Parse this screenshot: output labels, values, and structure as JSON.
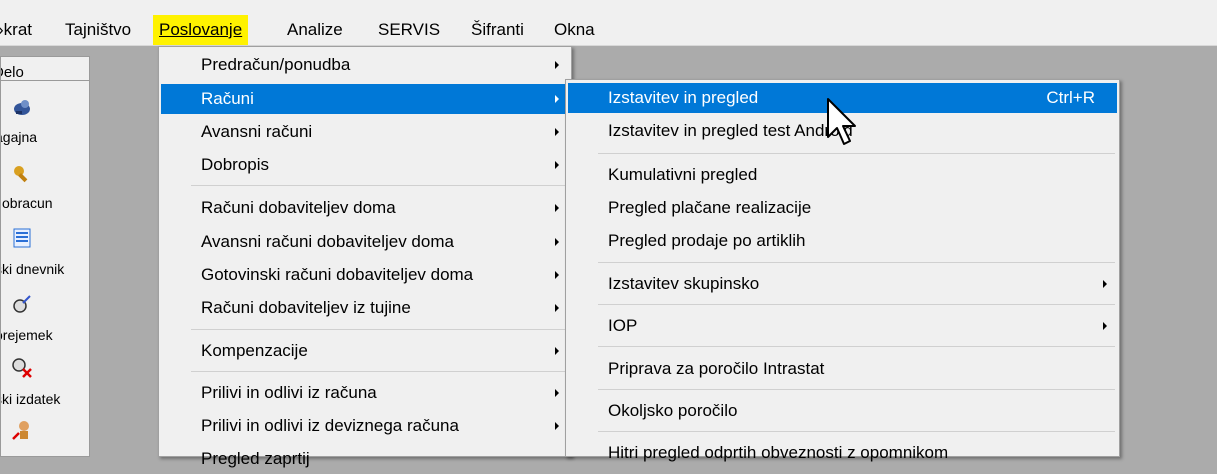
{
  "menubar": {
    "items": [
      "›krat",
      "Tajništvo",
      "Poslovanje",
      "Analize",
      "SERVIS",
      "Šifranti",
      "Okna"
    ],
    "open_index": 2
  },
  "sidebar": {
    "header": "Delo",
    "items": [
      {
        "label": "agajna",
        "icon": "register-icon"
      },
      {
        "label": "i obracun",
        "icon": "key-icon"
      },
      {
        "label": "ški dnevnik",
        "icon": "journal-icon"
      },
      {
        "label": "orejemek",
        "icon": "receipt-icon"
      },
      {
        "label": "ški izdatek",
        "icon": "expense-icon"
      },
      {
        "label": "",
        "icon": "person-icon"
      }
    ]
  },
  "poslovanje_menu": {
    "items": [
      {
        "label": "Predračun/ponudba",
        "submenu": true
      },
      {
        "label": "Računi",
        "submenu": true,
        "highlighted": true
      },
      {
        "label": "Avansni računi",
        "submenu": true
      },
      {
        "label": "Dobropis",
        "submenu": true
      },
      {
        "label": "Računi dobaviteljev doma",
        "submenu": true
      },
      {
        "label": "Avansni računi dobaviteljev doma",
        "submenu": true
      },
      {
        "label": "Gotovinski računi dobaviteljev doma",
        "submenu": true
      },
      {
        "label": "Računi dobaviteljev iz tujine",
        "submenu": true
      },
      {
        "label": "Kompenzacije",
        "submenu": true
      },
      {
        "label": "Prilivi in odlivi iz računa",
        "submenu": true
      },
      {
        "label": "Prilivi in odlivi iz deviznega računa",
        "submenu": true
      },
      {
        "label": "Pregled zaprtij",
        "submenu": false
      }
    ]
  },
  "racuni_submenu": {
    "items": [
      {
        "label": "Izstavitev in pregled",
        "shortcut": "Ctrl+R",
        "highlighted": true
      },
      {
        "label": "Izstavitev in pregled test Android"
      },
      {
        "label": "Kumulativni pregled"
      },
      {
        "label": "Pregled plačane realizacije"
      },
      {
        "label": "Pregled prodaje po artiklih"
      },
      {
        "label": "Izstavitev skupinsko",
        "submenu": true
      },
      {
        "label": "IOP",
        "submenu": true
      },
      {
        "label": "Priprava za poročilo Intrastat"
      },
      {
        "label": "Okoljsko poročilo"
      },
      {
        "label": "Hitri pregled odprtih obveznosti z opomnikom"
      }
    ]
  },
  "colors": {
    "highlight": "#0078d7",
    "menubar_open": "#fff200",
    "workspace": "#ababab",
    "menu_bg": "#f0f0f0"
  }
}
